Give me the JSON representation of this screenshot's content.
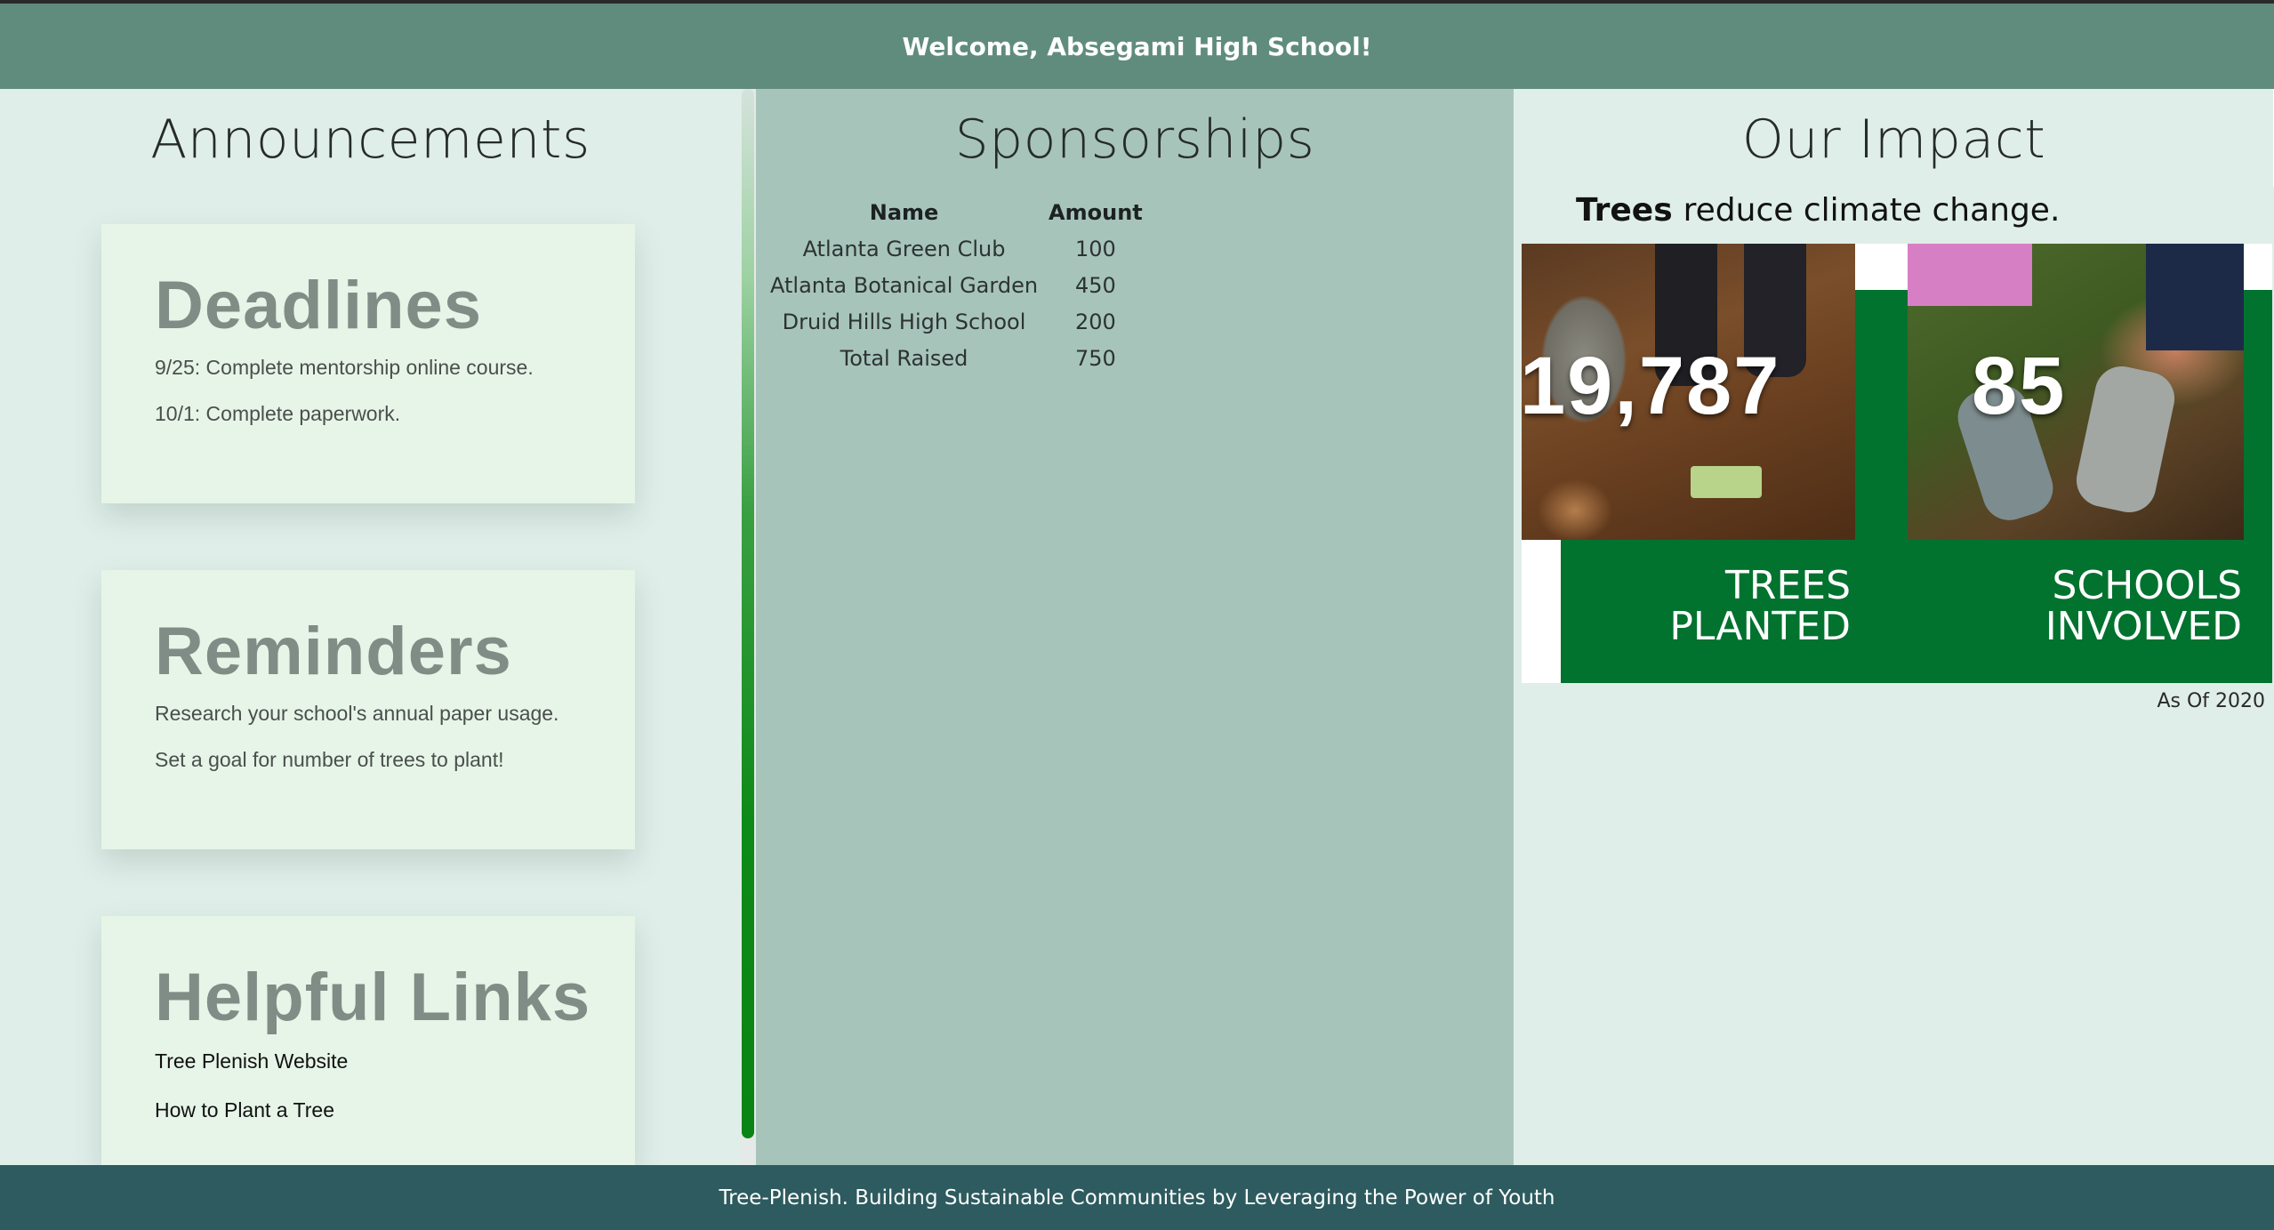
{
  "header": {
    "welcome": "Welcome, Absegami High School!"
  },
  "announcements": {
    "title": "Announcements",
    "deadlines": {
      "heading": "Deadlines",
      "items": [
        "9/25: Complete mentorship online course.",
        "10/1: Complete paperwork."
      ]
    },
    "reminders": {
      "heading": "Reminders",
      "items": [
        "Research your school's annual paper usage.",
        "Set a goal for number of trees to plant!"
      ]
    },
    "helpful_links": {
      "heading": "Helpful Links",
      "links": [
        "Tree Plenish Website",
        "How to Plant a Tree"
      ]
    }
  },
  "sponsorships": {
    "title": "Sponsorships",
    "columns": [
      "Name",
      "Amount"
    ],
    "rows": [
      {
        "name": "Atlanta Green Club",
        "amount": "100"
      },
      {
        "name": "Atlanta Botanical Garden",
        "amount": "450"
      },
      {
        "name": "Druid Hills High School",
        "amount": "200"
      },
      {
        "name": "Total Raised",
        "amount": "750"
      }
    ]
  },
  "impact": {
    "title": "Our Impact",
    "tagline_bold": "Trees",
    "tagline_rest": "reduce climate change.",
    "stats": [
      {
        "number": "19,787",
        "label_line1": "TREES",
        "label_line2": "PLANTED"
      },
      {
        "number": "85",
        "label_line1": "SCHOOLS",
        "label_line2": "INVOLVED"
      }
    ],
    "as_of": "As Of 2020"
  },
  "colors": {
    "header_bg": "#608c7e",
    "footer_bg": "#2d5b5f",
    "middle_bg": "#a7c4bb",
    "panel_bg": "#dfeee9",
    "card_bg": "#e6f5e7",
    "infographic_green": "#02722f"
  },
  "footer": {
    "text": "Tree-Plenish. Building Sustainable Communities by Leveraging the Power of Youth"
  }
}
